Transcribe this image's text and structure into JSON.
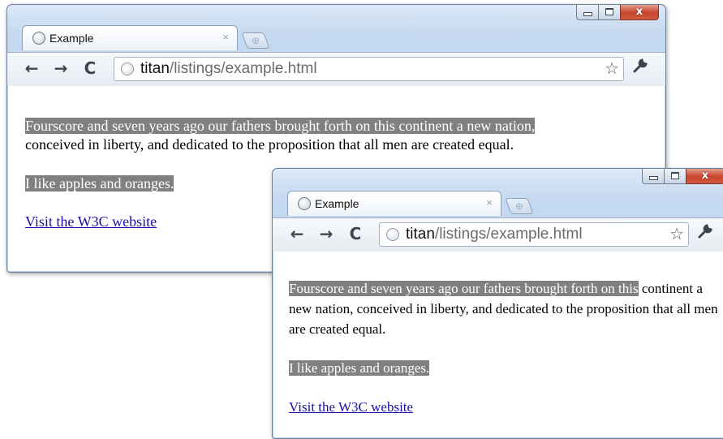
{
  "window_controls": {
    "minimize": "–",
    "maximize": "□",
    "close": "x"
  },
  "tab": {
    "title": "Example",
    "close": "×",
    "new_tab": "⊕"
  },
  "toolbar": {
    "back": "←",
    "forward": "→",
    "reload": "C",
    "url_host": "titan",
    "url_path": "/listings/example.html",
    "star": "☆",
    "wrench": "🔧"
  },
  "page": {
    "paragraph_highlight_wide": "Fourscore and seven years ago our fathers brought forth on this continent a new nation,",
    "paragraph_rest_wide": "conceived in liberty, and dedicated to the proposition that all men are created equal.",
    "paragraph_highlight_narrow": "Fourscore and seven years ago our fathers brought forth on this",
    "paragraph_rest_narrow": "continent a new nation, conceived in liberty, and dedicated to the proposition that all men are created equal.",
    "apples": "I like apples and oranges.",
    "link": "Visit the W3C website"
  }
}
